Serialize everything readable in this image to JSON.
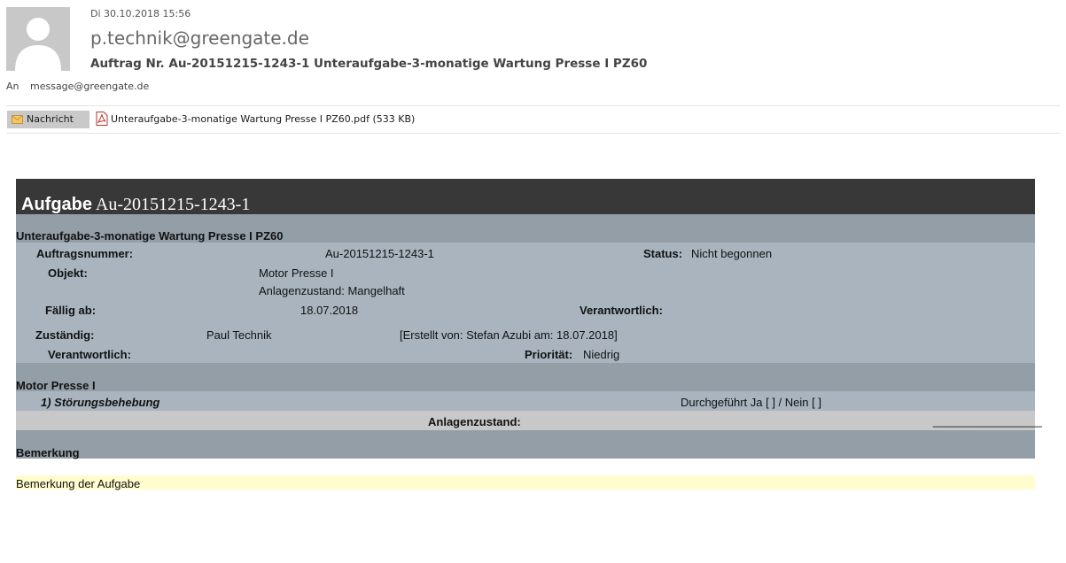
{
  "email": {
    "date": "Di 30.10.2018 15:56",
    "sender": "p.technik@greengate.de",
    "subject": "Auftrag Nr. Au-20151215-1243-1 Unteraufgabe-3-monatige Wartung Presse I PZ60",
    "to_label": "An",
    "to_value": "message@greengate.de",
    "tab_message": "Nachricht",
    "attachment": "Unteraufgabe-3-monatige Wartung Presse I PZ60.pdf (533 KB)"
  },
  "task": {
    "title_bold": "Aufgabe",
    "title_id": "Au-20151215-1243-1",
    "subtitle": "Unteraufgabe-3-monatige Wartung Presse I PZ60",
    "auftragsnummer_label": "Auftragsnummer:",
    "auftragsnummer_value": "Au-20151215-1243-1",
    "status_label": "Status:",
    "status_value": "Nicht begonnen",
    "objekt_label": "Objekt:",
    "objekt_value": "Motor Presse I",
    "anlagenzustand_value": "Anlagenzustand: Mangelhaft",
    "faellig_label": "Fällig ab:",
    "faellig_value": "18.07.2018",
    "verantwortlich_label_right": "Verantwortlich:",
    "zustaendig_label": "Zuständig:",
    "zustaendig_value": "Paul Technik",
    "erstellt": "[Erstellt von: Stefan Azubi am: 18.07.2018]",
    "verantwortlich_label": "Verantwortlich:",
    "prioritaet_label": "Priorität:",
    "prioritaet_value": "Niedrig",
    "section_object": "Motor Presse I",
    "step_title": "1) Störungsbehebung",
    "durchgefuehrt": "Durchgeführt  Ja [ ] / Nein [ ]",
    "anlagenzustand_label": "Anlagenzustand:",
    "line_blank": "_________________",
    "bemerkung_heading": "Bemerkung",
    "bemerkung_text": "Bemerkung der Aufgabe"
  },
  "colors": {
    "header_dark": "#383838",
    "band_gray": "#949ea7",
    "band_light": "#a9b4bf",
    "band_pale": "#c8c8c8",
    "note_yellow": "#fffdcd"
  }
}
